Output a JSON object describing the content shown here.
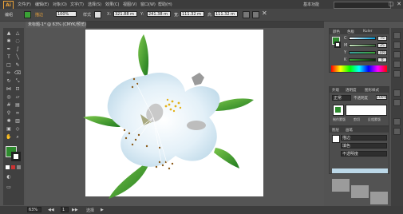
{
  "menubar": {
    "logo": "Ai",
    "items": [
      "文件(F)",
      "编辑(E)",
      "对象(O)",
      "文字(T)",
      "选择(S)",
      "效果(C)",
      "视图(V)",
      "窗口(W)",
      "帮助(H)"
    ],
    "workspace": "基本功能",
    "window_controls": [
      "—",
      "▢",
      "✕"
    ]
  },
  "control_bar": {
    "selection": "编组",
    "stroke_label": "描边",
    "stroke_value": "不透明度",
    "opacity_value": "100%",
    "style_label": "样式",
    "transform_labels": [
      "X:",
      "Y:",
      "宽:",
      "高:"
    ],
    "transform_values": [
      "321.88 m",
      "241.38 m",
      "111.32 m",
      "111.32 m"
    ]
  },
  "document": {
    "tab_title": "未标题-1* @ 63% (CMYK/预览)"
  },
  "color_panel": {
    "tabs": [
      "颜色",
      "色板",
      "Kuler"
    ],
    "channels": [
      {
        "name": "C",
        "value": "75",
        "unit": "%"
      },
      {
        "name": "M",
        "value": "25",
        "unit": "%"
      },
      {
        "name": "Y",
        "value": "100",
        "unit": "%"
      },
      {
        "name": "K",
        "value": "0",
        "unit": "%"
      }
    ]
  },
  "appearance_panel": {
    "tabs": [
      "外观",
      "透明度",
      "图形样式"
    ],
    "mode": "正常",
    "opacity_label": "不透明度",
    "opacity_value": "100%",
    "buttons": [
      "制作蒙版",
      "剪切",
      "反相蒙版"
    ]
  },
  "layers_panel": {
    "tabs": [
      "图层",
      "画笔"
    ],
    "rows": [
      "描边",
      "填色",
      "不透明度"
    ]
  },
  "status_bar": {
    "zoom": "63%",
    "page": "1",
    "tool": "选择"
  },
  "colors": {
    "fill": "#2e8b2e",
    "accent_green": "#3aa135",
    "petal": "#dbeaf4"
  }
}
